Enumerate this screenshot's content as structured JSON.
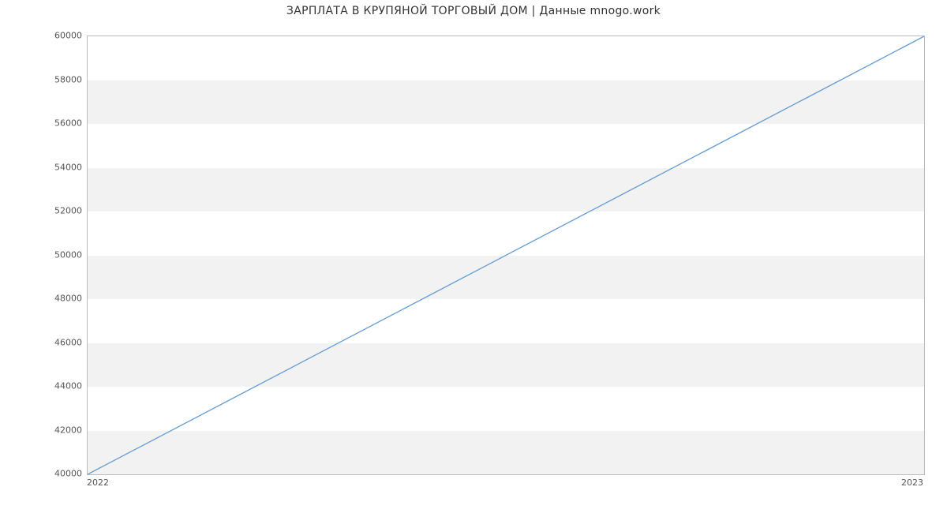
{
  "chart_data": {
    "type": "line",
    "title": "ЗАРПЛАТА В  КРУПЯНОЙ ТОРГОВЫЙ ДОМ | Данные mnogo.work",
    "xlabel": "",
    "ylabel": "",
    "x": [
      2022,
      2023
    ],
    "values": [
      40000,
      60000
    ],
    "x_ticks": [
      2022,
      2023
    ],
    "y_ticks": [
      40000,
      42000,
      44000,
      46000,
      48000,
      50000,
      52000,
      54000,
      56000,
      58000,
      60000
    ],
    "xlim": [
      2022,
      2023
    ],
    "ylim": [
      40000,
      60000
    ],
    "line_color": "#6a9ed4"
  }
}
